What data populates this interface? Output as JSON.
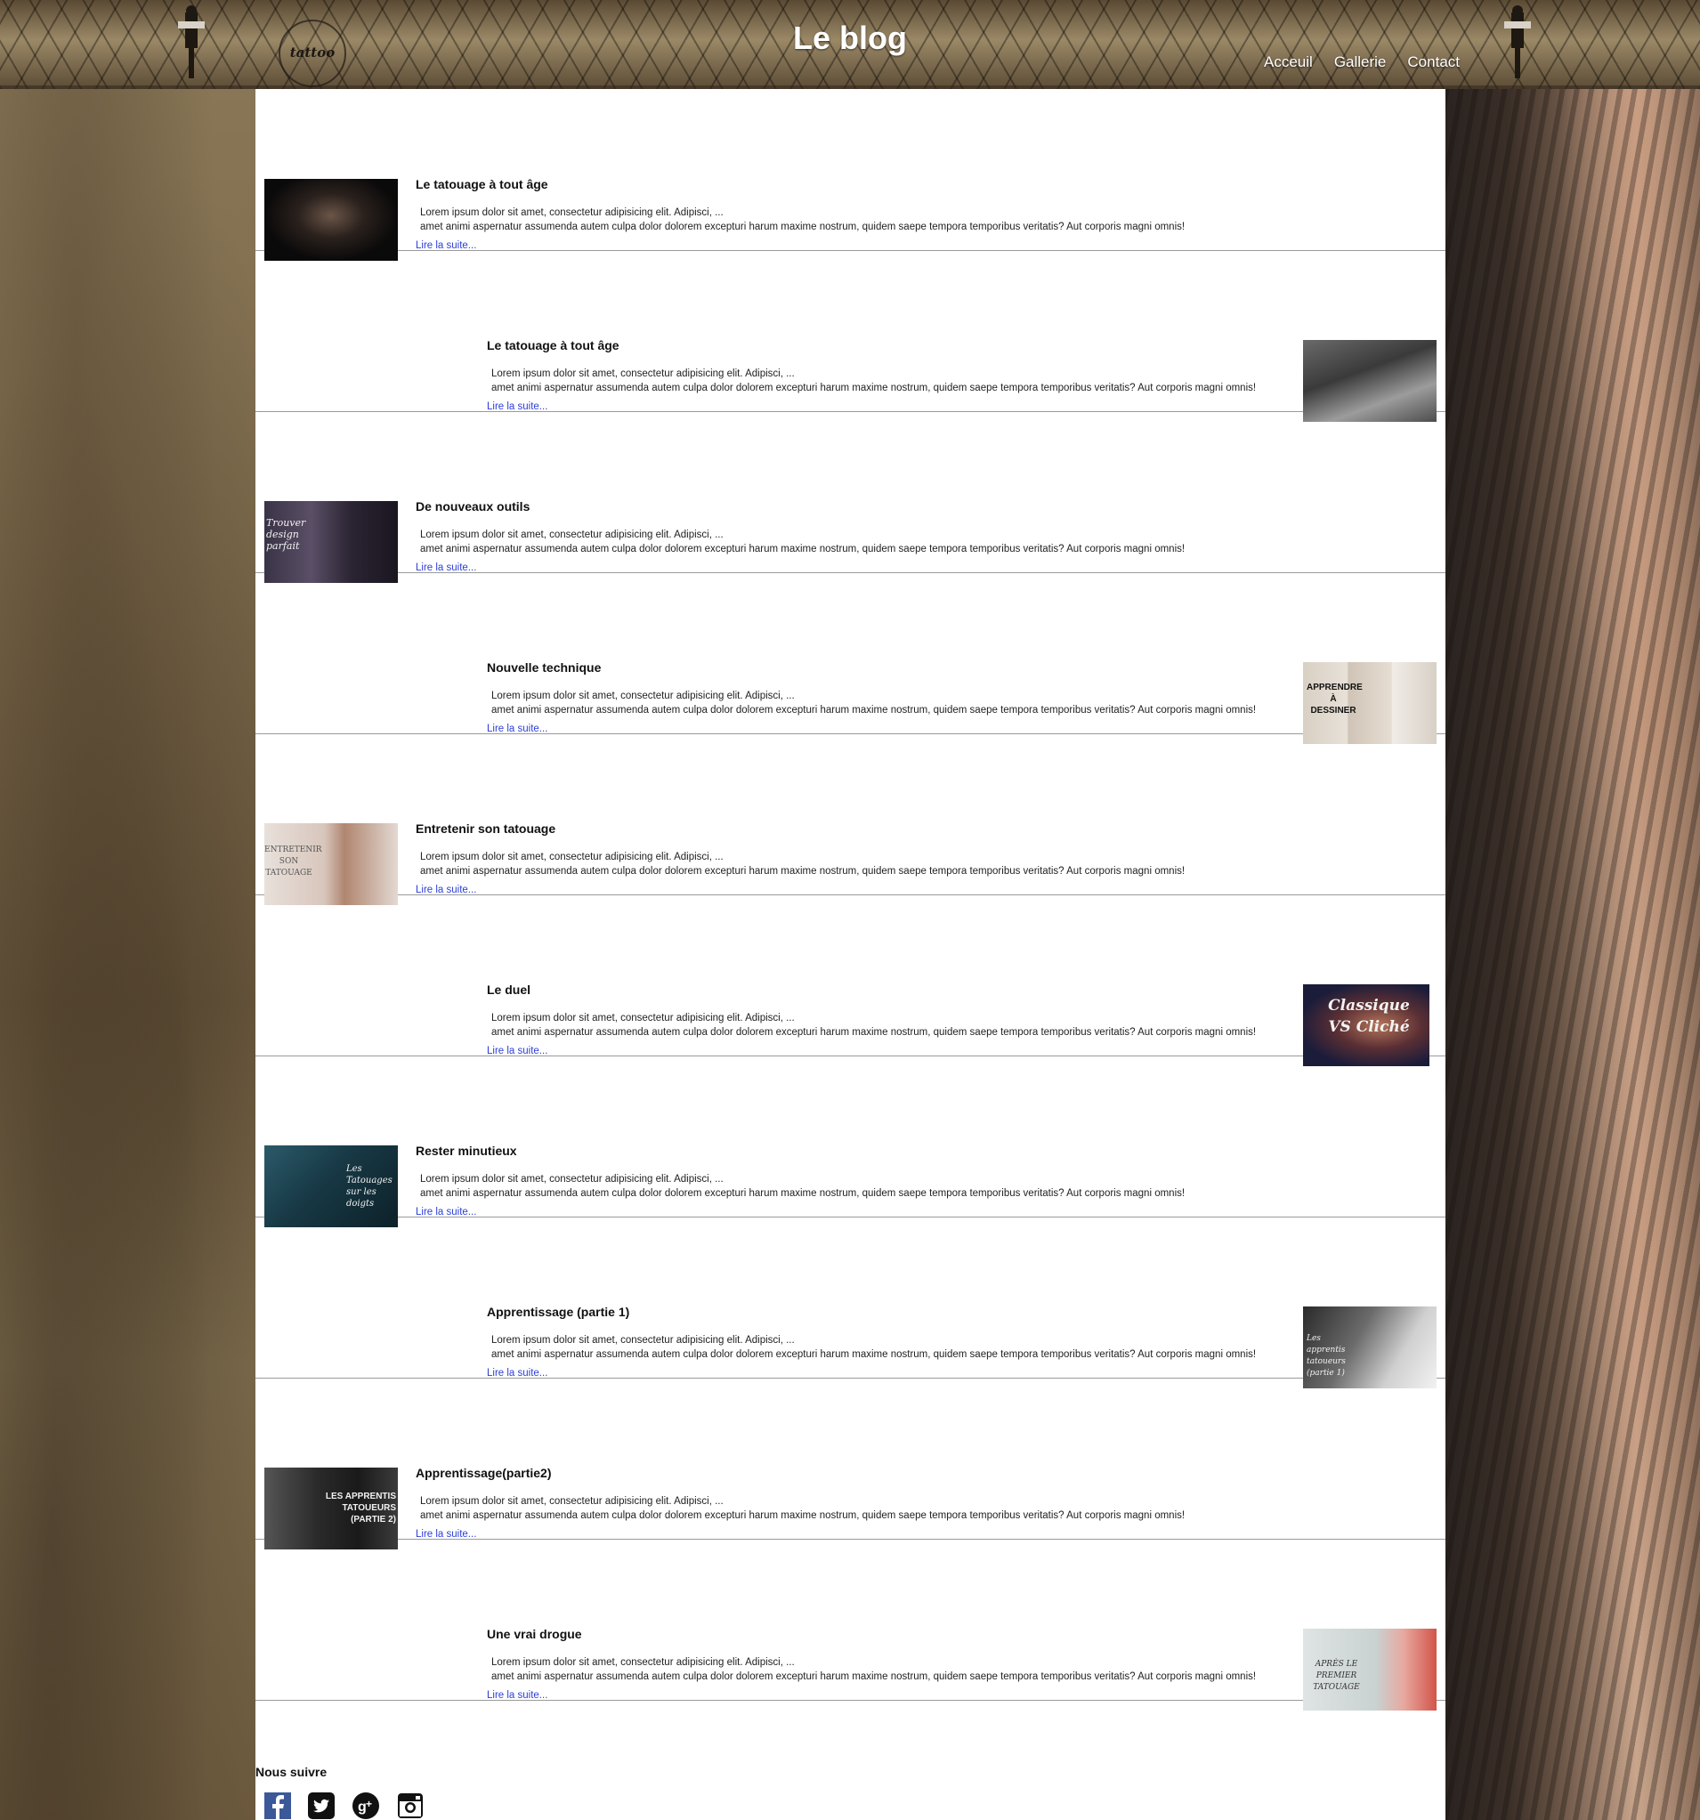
{
  "header": {
    "title": "Le blog",
    "logo_text": "tattoo",
    "nav": [
      "Acceuil",
      "Gallerie",
      "Contact"
    ]
  },
  "posts": [
    {
      "title": "Le tatouage à tout âge",
      "line1": "Lorem ipsum dolor sit amet, consectetur adipisicing elit. Adipisci, ...",
      "line2": "amet animi aspernatur assumenda autem culpa dolor dolorem excepturi harum maxime nostrum, quidem saepe tempora temporibus veritatis? Aut corporis magni omnis!",
      "link": "Lire la suite...",
      "image_side": "left",
      "thumb_text": ""
    },
    {
      "title": "Le tatouage à tout âge",
      "line1": "Lorem ipsum dolor sit amet, consectetur adipisicing elit. Adipisci, ...",
      "line2": "amet animi aspernatur assumenda autem culpa dolor dolorem excepturi harum maxime nostrum, quidem saepe tempora temporibus veritatis? Aut corporis magni omnis!",
      "link": "Lire la suite...",
      "image_side": "right",
      "thumb_text": ""
    },
    {
      "title": "De nouveaux outils",
      "line1": "Lorem ipsum dolor sit amet, consectetur adipisicing elit. Adipisci, ...",
      "line2": "amet animi aspernatur assumenda autem culpa dolor dolorem excepturi harum maxime nostrum, quidem saepe tempora temporibus veritatis? Aut corporis magni omnis!",
      "link": "Lire la suite...",
      "image_side": "left",
      "thumb_text": "Trouver design parfait"
    },
    {
      "title": "Nouvelle technique",
      "line1": "Lorem ipsum dolor sit amet, consectetur adipisicing elit. Adipisci, ...",
      "line2": "amet animi aspernatur assumenda autem culpa dolor dolorem excepturi harum maxime nostrum, quidem saepe tempora temporibus veritatis? Aut corporis magni omnis!",
      "link": "Lire la suite...",
      "image_side": "right",
      "thumb_text": "APPRENDRE À DESSINER"
    },
    {
      "title": "Entretenir son tatouage",
      "line1": "Lorem ipsum dolor sit amet, consectetur adipisicing elit. Adipisci, ...",
      "line2": "amet animi aspernatur assumenda autem culpa dolor dolorem excepturi harum maxime nostrum, quidem saepe tempora temporibus veritatis? Aut corporis magni omnis!",
      "link": "Lire la suite...",
      "image_side": "left",
      "thumb_text": "ENTRETENIR SON TATOUAGE"
    },
    {
      "title": "Le duel",
      "line1": "Lorem ipsum dolor sit amet, consectetur adipisicing elit. Adipisci, ...",
      "line2": "amet animi aspernatur assumenda autem culpa dolor dolorem excepturi harum maxime nostrum, quidem saepe tempora temporibus veritatis? Aut corporis magni omnis!",
      "link": "Lire la suite...",
      "image_side": "right",
      "thumb_text": "Classique VS Cliché"
    },
    {
      "title": "Rester minutieux",
      "line1": "Lorem ipsum dolor sit amet, consectetur adipisicing elit. Adipisci, ...",
      "line2": "amet animi aspernatur assumenda autem culpa dolor dolorem excepturi harum maxime nostrum, quidem saepe tempora temporibus veritatis? Aut corporis magni omnis!",
      "link": "Lire la suite...",
      "image_side": "left",
      "thumb_text": "Les Tatouages sur les doigts"
    },
    {
      "title": "Apprentissage (partie 1)",
      "line1": "Lorem ipsum dolor sit amet, consectetur adipisicing elit. Adipisci, ...",
      "line2": "amet animi aspernatur assumenda autem culpa dolor dolorem excepturi harum maxime nostrum, quidem saepe tempora temporibus veritatis? Aut corporis magni omnis!",
      "link": "Lire la suite...",
      "image_side": "right",
      "thumb_text": "Les apprentis tatoueurs (partie 1)"
    },
    {
      "title": "Apprentissage(partie2)",
      "line1": "Lorem ipsum dolor sit amet, consectetur adipisicing elit. Adipisci, ...",
      "line2": "amet animi aspernatur assumenda autem culpa dolor dolorem excepturi harum maxime nostrum, quidem saepe tempora temporibus veritatis? Aut corporis magni omnis!",
      "link": "Lire la suite...",
      "image_side": "left",
      "thumb_text": "LES APPRENTIS TATOUEURS (PARTIE 2)"
    },
    {
      "title": "Une vrai drogue",
      "line1": "Lorem ipsum dolor sit amet, consectetur adipisicing elit. Adipisci, ...",
      "line2": "amet animi aspernatur assumenda autem culpa dolor dolorem excepturi harum maxime nostrum, quidem saepe tempora temporibus veritatis? Aut corporis magni omnis!",
      "link": "Lire la suite...",
      "image_side": "right",
      "thumb_text": "APRÈS LE PREMIER TATOUAGE"
    }
  ],
  "footer": {
    "follow_label": "Nous suivre",
    "social_icons": [
      "facebook-icon",
      "twitter-icon",
      "google-plus-icon",
      "instagram-icon"
    ]
  },
  "colors": {
    "link": "#2b3fd8",
    "panel_bg": "#ffffff",
    "title_text": "#ffffff"
  }
}
